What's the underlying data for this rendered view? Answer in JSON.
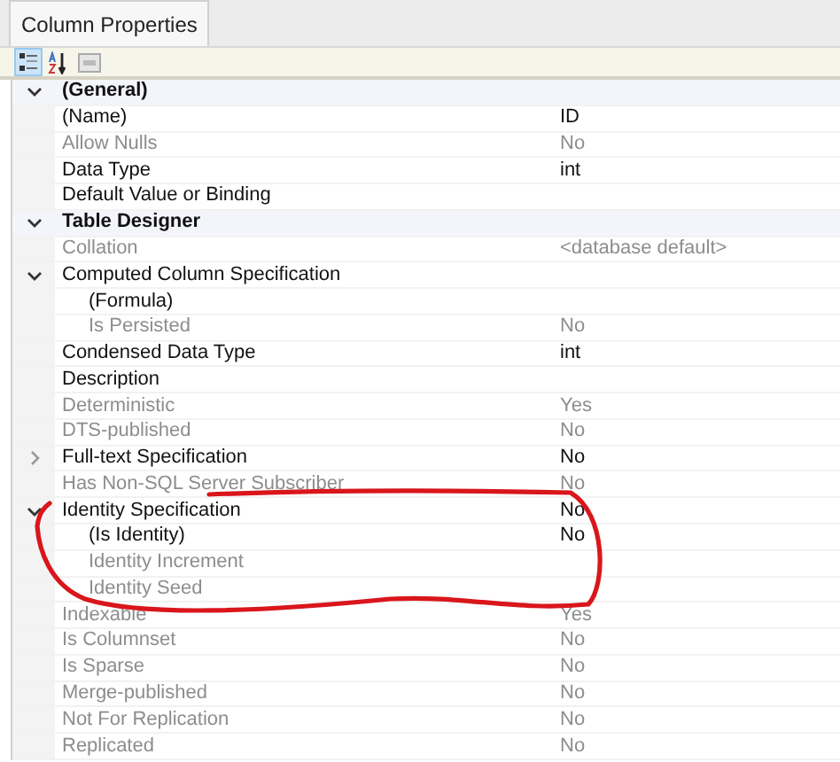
{
  "tab": {
    "label": "Column Properties",
    "selected": true
  },
  "toolbar": [
    {
      "kind": "categorized",
      "selected": true
    },
    {
      "kind": "alphabetical",
      "selected": false
    },
    {
      "kind": "pages",
      "selected": false
    }
  ],
  "categories": [
    {
      "name": "(General)",
      "expanded": true,
      "properties": [
        {
          "name": "(Name)",
          "value": "ID",
          "disabled": false
        },
        {
          "name": "Allow Nulls",
          "value": "No",
          "disabled": true
        },
        {
          "name": "Data Type",
          "value": "int",
          "disabled": false
        },
        {
          "name": "Default Value or Binding",
          "disabled": false
        }
      ]
    },
    {
      "name": "Table Designer",
      "expanded": true,
      "properties": [
        {
          "name": "Collation",
          "value": "<database default>",
          "disabled": true
        },
        {
          "name": "Computed Column Specification",
          "disabled": false,
          "expanded": true,
          "children": [
            {
              "name": "(Formula)",
              "disabled": false
            },
            {
              "name": "Is Persisted",
              "value": "No",
              "disabled": true
            }
          ]
        },
        {
          "name": "Condensed Data Type",
          "value": "int",
          "disabled": false
        },
        {
          "name": "Description",
          "disabled": false
        },
        {
          "name": "Deterministic",
          "value": "Yes",
          "disabled": true
        },
        {
          "name": "DTS-published",
          "value": "No",
          "disabled": true
        },
        {
          "name": "Full-text Specification",
          "value": "No",
          "disabled": false,
          "expanded": false
        },
        {
          "name": "Has Non-SQL Server Subscriber",
          "value": "No",
          "disabled": true
        },
        {
          "name": "Identity Specification",
          "value": "No",
          "disabled": false,
          "expanded": true,
          "children": [
            {
              "name": "(Is Identity)",
              "value": "No",
              "disabled": false
            },
            {
              "name": "Identity Increment",
              "disabled": true
            },
            {
              "name": "Identity Seed",
              "disabled": true
            }
          ]
        },
        {
          "name": "Indexable",
          "value": "Yes",
          "disabled": true
        },
        {
          "name": "Is Columnset",
          "value": "No",
          "disabled": true
        },
        {
          "name": "Is Sparse",
          "value": "No",
          "disabled": true
        },
        {
          "name": "Merge-published",
          "value": "No",
          "disabled": true
        },
        {
          "name": "Not For Replication",
          "value": "No",
          "disabled": true
        },
        {
          "name": "Replicated",
          "value": "No",
          "disabled": true
        }
      ]
    }
  ]
}
